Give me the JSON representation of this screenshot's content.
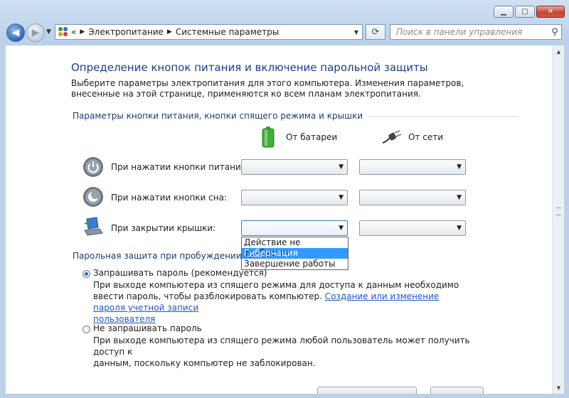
{
  "breadcrumb": {
    "overflow": "«",
    "items": [
      "Электропитание",
      "Системные параметры"
    ]
  },
  "search": {
    "placeholder": "Поиск в панели управления"
  },
  "page": {
    "title": "Определение кнопок питания и включение парольной защиты",
    "description": "Выберите параметры электропитания для этого компьютера. Изменения параметров, внесенные на этой странице, применяются ко всем планам электропитания."
  },
  "power_buttons": {
    "group_label": "Параметры кнопки питания, кнопки спящего режима и крышки",
    "columns": {
      "battery": "От батареи",
      "ac": "От сети"
    },
    "rows": [
      {
        "label": "При нажатии кнопки питания:",
        "battery_value": "",
        "ac_value": ""
      },
      {
        "label": "При нажатии кнопки сна:",
        "battery_value": "",
        "ac_value": ""
      },
      {
        "label": "При закрытии крышки:",
        "battery_value": "",
        "ac_value": ""
      }
    ],
    "open_dropdown": {
      "options": [
        "Действие не требуется",
        "Гибернация",
        "Завершение работы"
      ],
      "highlighted": "Гибернация"
    }
  },
  "password": {
    "group_label": "Парольная защита при пробуждении",
    "options": [
      {
        "label": "Запрашивать пароль (рекомендуется)",
        "selected": true,
        "description": "При выходе компьютера из спящего режима для доступа к данным необходимо ввести пароль, чтобы разблокировать компьютер.",
        "link_part1": "Создание или изменение пароля учетной записи",
        "link_part2": "пользователя"
      },
      {
        "label": "Не запрашивать пароль",
        "selected": false,
        "description_line1": "При выходе компьютера из спящего режима любой пользователь может получить доступ к",
        "description_line2": "данным, поскольку компьютер не заблокирован."
      }
    ]
  },
  "colors": {
    "title": "#1e3c8c",
    "link": "#1f55c6",
    "selection": "#3399ff",
    "close_button": "#c7452f"
  },
  "icons": {
    "back": "arrow-left-icon",
    "forward": "arrow-right-icon",
    "refresh": "refresh-icon",
    "search": "magnifier-icon",
    "battery": "battery-icon",
    "ac": "power-plug-icon",
    "power_button": "power-button-icon",
    "sleep_button": "sleep-moon-icon",
    "lid": "laptop-lid-icon"
  }
}
